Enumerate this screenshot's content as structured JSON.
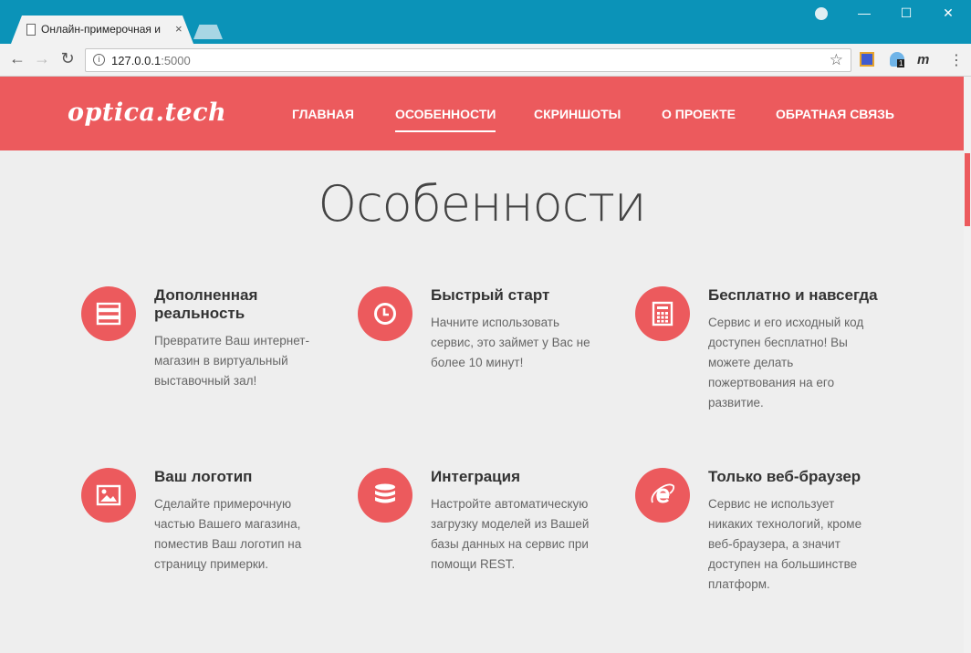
{
  "browser": {
    "tab_title": "Онлайн-примерочная и",
    "tab_close": "×",
    "url_host": "127.0.0.1",
    "url_port": ":5000",
    "ext_badge": "1",
    "ext_m": "m",
    "win_min": "—",
    "win_max": "☐",
    "win_close": "✕"
  },
  "header": {
    "logo": "optica.tech",
    "nav": [
      "ГЛАВНАЯ",
      "ОСОБЕННОСТИ",
      "СКРИНШОТЫ",
      "О ПРОЕКТЕ",
      "ОБРАТНАЯ СВЯЗЬ"
    ],
    "active_nav": "ОСОБЕННОСТИ"
  },
  "section": {
    "title": "Особенности"
  },
  "features": [
    {
      "icon": "server-icon",
      "title": "Дополненная реальность",
      "text": "Превратите Ваш интернет-магазин в виртуальный выставочный зал!"
    },
    {
      "icon": "clock-icon",
      "title": "Быстрый старт",
      "text": "Начните использовать сервис, это займет у Вас не более 10 минут!"
    },
    {
      "icon": "calculator-icon",
      "title": "Бесплатно и навсегда",
      "text": "Сервис и его исходный код доступен бесплатно! Вы можете делать пожертвования на его развитие."
    },
    {
      "icon": "image-icon",
      "title": "Ваш логотип",
      "text": "Сделайте примерочную частью Вашего магазина, поместив Ваш логотип на страницу примерки."
    },
    {
      "icon": "database-icon",
      "title": "Интеграция",
      "text": "Настройте автоматическую загрузку моделей из Вашей базы данных на сервис при помощи REST."
    },
    {
      "icon": "ie-browser-icon",
      "title": "Только веб-браузер",
      "text": "Сервис не использует никаких технологий, кроме веб-браузера, а значит доступен на большинстве платформ."
    }
  ],
  "colors": {
    "accent": "#ec5a5d",
    "chrome": "#0b93b8",
    "page_bg": "#eeeeee"
  }
}
